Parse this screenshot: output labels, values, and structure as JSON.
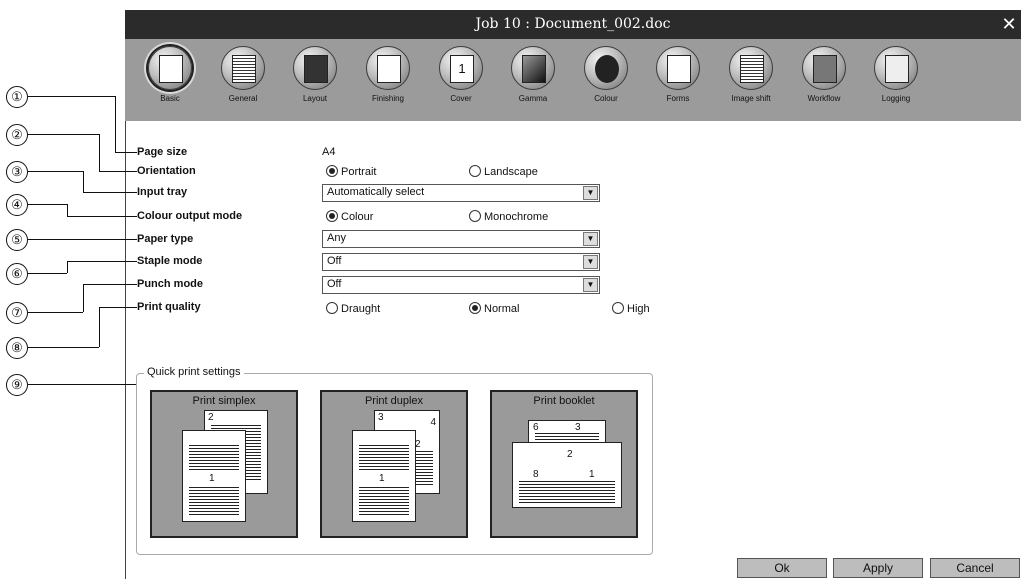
{
  "window": {
    "title": "Job 10 : Document_002.doc"
  },
  "toolbar": {
    "items": [
      {
        "label": "Basic",
        "icon": "basic-icon"
      },
      {
        "label": "General",
        "icon": "general-icon"
      },
      {
        "label": "Layout",
        "icon": "layout-icon"
      },
      {
        "label": "Finishing",
        "icon": "finishing-icon"
      },
      {
        "label": "Cover",
        "icon": "cover-icon"
      },
      {
        "label": "Gamma",
        "icon": "gamma-icon"
      },
      {
        "label": "Colour",
        "icon": "colour-icon"
      },
      {
        "label": "Forms",
        "icon": "forms-icon"
      },
      {
        "label": "Image shift",
        "icon": "image-shift-icon"
      },
      {
        "label": "Workflow",
        "icon": "workflow-icon"
      },
      {
        "label": "Logging",
        "icon": "logging-icon"
      }
    ],
    "selected": "Basic",
    "cover_glyph": "1"
  },
  "annotations": [
    "①",
    "②",
    "③",
    "④",
    "⑤",
    "⑥",
    "⑦",
    "⑧",
    "⑨"
  ],
  "form": {
    "page_size": {
      "label": "Page size",
      "value": "A4"
    },
    "orientation": {
      "label": "Orientation",
      "options": [
        "Portrait",
        "Landscape"
      ],
      "selected": "Portrait"
    },
    "input_tray": {
      "label": "Input tray",
      "value": "Automatically select"
    },
    "colour_output_mode": {
      "label": "Colour output mode",
      "options": [
        "Colour",
        "Monochrome"
      ],
      "selected": "Colour"
    },
    "paper_type": {
      "label": "Paper type",
      "value": "Any"
    },
    "staple_mode": {
      "label": "Staple mode",
      "value": "Off"
    },
    "punch_mode": {
      "label": "Punch mode",
      "value": "Off"
    },
    "print_quality": {
      "label": "Print quality",
      "options": [
        "Draught",
        "Normal",
        "High"
      ],
      "selected": "Normal"
    }
  },
  "quick_print": {
    "title": "Quick print settings",
    "buttons": [
      {
        "label": "Print simplex",
        "pages": [
          "2",
          "1"
        ]
      },
      {
        "label": "Print duplex",
        "pages": [
          "3",
          "4",
          "2",
          "1"
        ]
      },
      {
        "label": "Print booklet",
        "pages": [
          "6",
          "3",
          "8",
          "1",
          "2"
        ]
      }
    ]
  },
  "footer": {
    "ok": "Ok",
    "apply": "Apply",
    "cancel": "Cancel"
  }
}
